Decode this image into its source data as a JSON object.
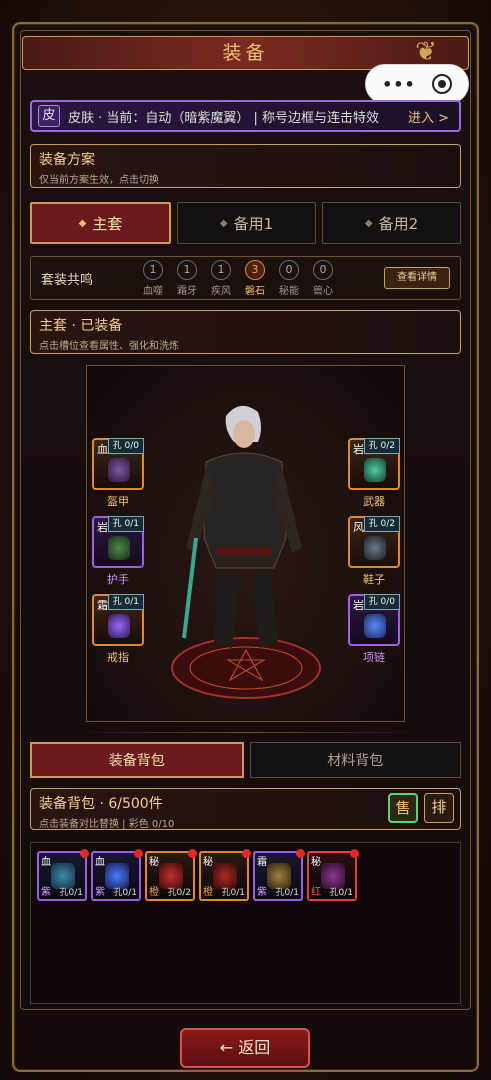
{
  "title": "装备",
  "capsule": {
    "more_icon": "more-dots-icon",
    "close_icon": "target-circle-icon"
  },
  "skin": {
    "tag": "皮",
    "text": "皮肤 · 当前：自动（暗紫魔翼） | 称号边框与连击特效",
    "enter": "进入 >"
  },
  "scheme": {
    "title": "装备方案",
    "subtitle": "仅当前方案生效，点击切换"
  },
  "scheme_tabs": [
    {
      "label": "主套",
      "active": true
    },
    {
      "label": "备用1",
      "active": false
    },
    {
      "label": "备用2",
      "active": false
    }
  ],
  "set_resonance": {
    "label": "套装共鸣",
    "items": [
      {
        "count": "1",
        "name": "血噬"
      },
      {
        "count": "1",
        "name": "霜牙"
      },
      {
        "count": "1",
        "name": "疾风"
      },
      {
        "count": "3",
        "name": "磐石",
        "active": true
      },
      {
        "count": "0",
        "name": "秘能"
      },
      {
        "count": "0",
        "name": "兽心"
      }
    ],
    "detail_button": "查看详情"
  },
  "equipped": {
    "title": "主套 · 已装备",
    "subtitle": "点击槽位查看属性、强化和洗炼"
  },
  "slots": [
    {
      "key": "血",
      "holes": "孔 0/0",
      "label": "盔甲",
      "color": "orange"
    },
    {
      "key": "岩",
      "holes": "孔 0/1",
      "label": "护手",
      "color": "purple"
    },
    {
      "key": "霜",
      "holes": "孔 0/1",
      "label": "戒指",
      "color": "orange"
    },
    {
      "key": "岩",
      "holes": "孔 0/2",
      "label": "武器",
      "color": "orange"
    },
    {
      "key": "风",
      "holes": "孔 0/2",
      "label": "鞋子",
      "color": "orange"
    },
    {
      "key": "岩",
      "holes": "孔 0/0",
      "label": "项链",
      "color": "purple"
    }
  ],
  "bag_tabs": [
    {
      "label": "装备背包",
      "active": true
    },
    {
      "label": "材料背包",
      "active": false
    }
  ],
  "bag": {
    "title": "装备背包 · 6/500件",
    "subtitle": "点击装备对比替换 | 彩色 0/10",
    "sell": "售",
    "sort": "排"
  },
  "items": [
    {
      "key": "血",
      "quality": "紫",
      "holes": "孔0/1",
      "color": "purple"
    },
    {
      "key": "血",
      "quality": "紫",
      "holes": "孔0/1",
      "color": "purple"
    },
    {
      "key": "秘",
      "quality": "橙",
      "holes": "孔0/2",
      "color": "orange"
    },
    {
      "key": "秘",
      "quality": "橙",
      "holes": "孔0/1",
      "color": "orange"
    },
    {
      "key": "霜",
      "quality": "紫",
      "holes": "孔0/1",
      "color": "purple"
    },
    {
      "key": "秘",
      "quality": "红",
      "holes": "孔0/1",
      "color": "red"
    }
  ],
  "back_button": "← 返回"
}
